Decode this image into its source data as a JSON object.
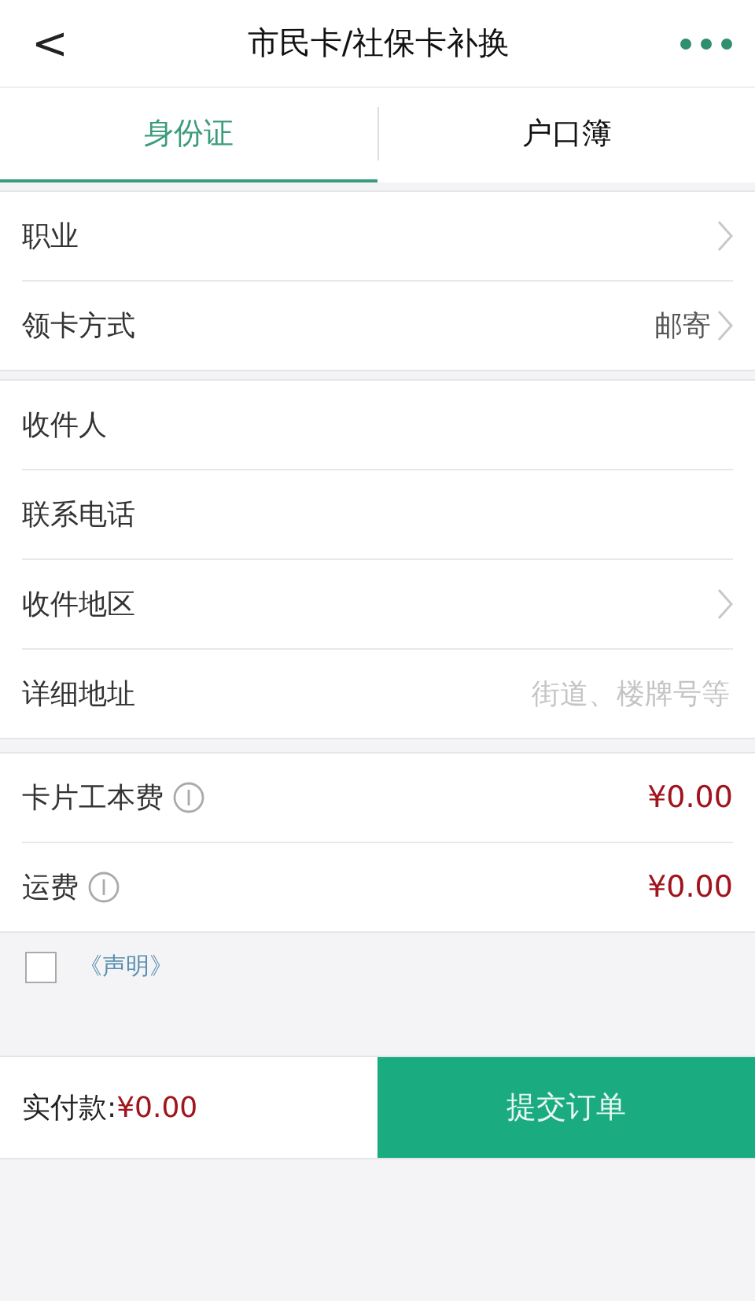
{
  "header": {
    "back": "<",
    "title": "市民卡/社保卡补换"
  },
  "tabs": [
    {
      "label": "身份证",
      "selected": true
    },
    {
      "label": "户口簿",
      "selected": false
    }
  ],
  "sections": [
    {
      "rows": [
        {
          "kind": "chevron",
          "label": "职业"
        },
        {
          "kind": "chevron",
          "label": "领卡方式",
          "value": "邮寄"
        }
      ]
    },
    {
      "rows": [
        {
          "kind": "input",
          "label": "收件人"
        },
        {
          "kind": "input",
          "label": "联系电话"
        },
        {
          "kind": "chevron",
          "label": "收件地区"
        },
        {
          "kind": "input",
          "label": "详细地址",
          "placeholder": "街道、楼牌号等"
        }
      ]
    }
  ],
  "fees": [
    {
      "label": "卡片工本费",
      "amount": "¥0.00"
    },
    {
      "label": "运费",
      "amount": "¥0.00"
    }
  ],
  "statement": {
    "checked": false,
    "link": "《声明》"
  },
  "footer": {
    "label": "实付款:",
    "amount": "¥0.00",
    "button": "提交订单"
  }
}
